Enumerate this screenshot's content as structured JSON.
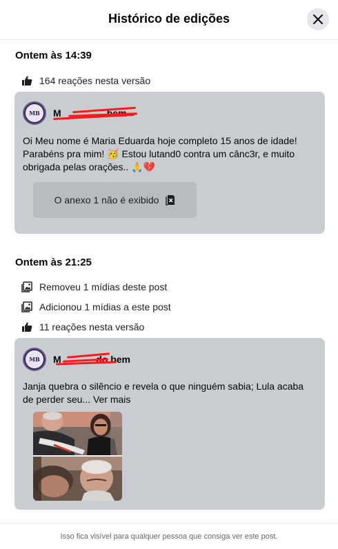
{
  "header": {
    "title": "Histórico de edições",
    "close_icon": "close-icon"
  },
  "versions": [
    {
      "timestamp": "Ontem às 14:39",
      "changes": [
        {
          "icon": "thumbs-up-icon",
          "text": "164 reações nesta versão"
        }
      ],
      "post": {
        "author_name": "M                 bem",
        "author_redacted": true,
        "avatar_initials": "MB",
        "text": "Oi Meu nome é Maria Eduarda hoje completo 15 anos de idade! Parabéns pra mim! 🥳 Estou lutand0 contra um cânc3r, e muito obrigada pelas orações.. 🙏💔",
        "attachment_label": "O anexo 1 não é exibido",
        "attachment_icon": "hidden-attachment-icon"
      }
    },
    {
      "timestamp": "Ontem às 21:25",
      "changes": [
        {
          "icon": "photo-icon",
          "text": "Removeu 1 mídias deste post"
        },
        {
          "icon": "photo-icon",
          "text": "Adicionou 1 mídias a este post"
        },
        {
          "icon": "thumbs-up-icon",
          "text": "11 reações nesta versão"
        }
      ],
      "post": {
        "author_name": "M             do bem",
        "author_redacted": true,
        "avatar_initials": "MB",
        "text": "Janja quebra o silêncio e revela o que ninguém sabia; Lula acaba de perder seu... Ver mais",
        "media": "photo-collage"
      }
    }
  ],
  "footer": {
    "text": "Isso fica visível para qualquer pessoa que consiga ver este post."
  }
}
